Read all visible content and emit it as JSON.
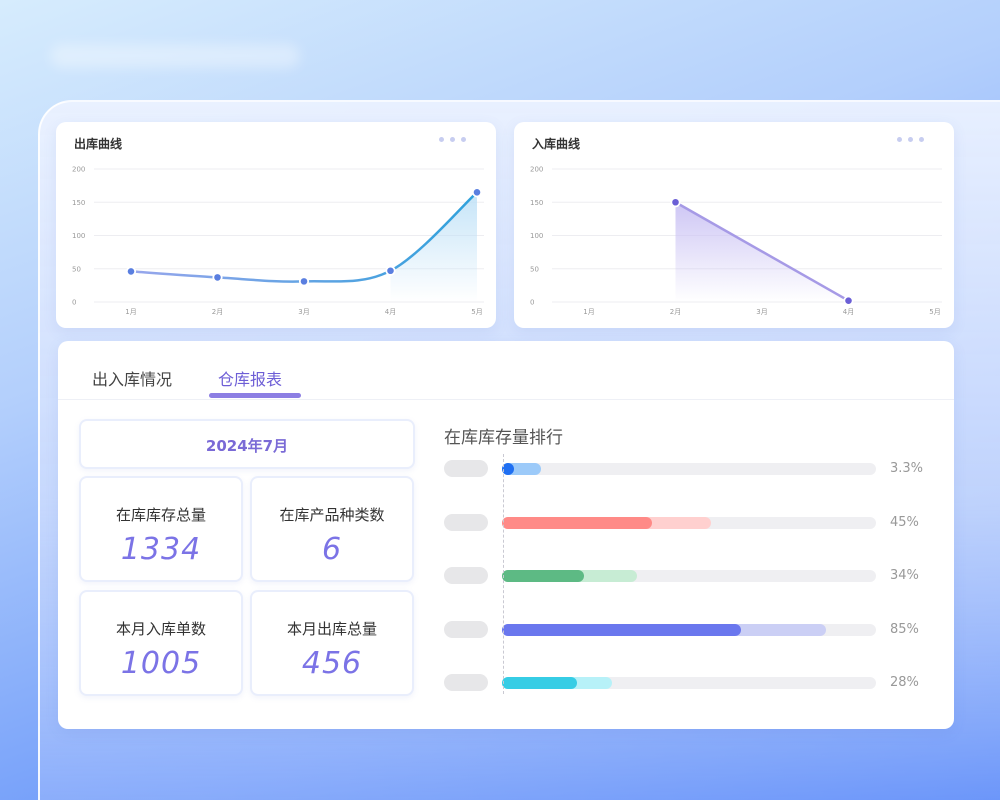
{
  "chart_data": [
    {
      "type": "area",
      "title": "出库曲线",
      "categories": [
        "1月",
        "2月",
        "3月",
        "4月",
        "5月"
      ],
      "values": [
        46,
        37,
        31,
        47,
        165
      ],
      "ylim": [
        0,
        200
      ],
      "yticks": [
        0,
        50,
        100,
        150,
        200
      ],
      "grid": true,
      "colors": {
        "line_start": "#98a6ec",
        "line_end": "#2ea1db",
        "fill": "#bfe1f7",
        "point": "#5a7fe0"
      }
    },
    {
      "type": "area",
      "title": "入库曲线",
      "categories": [
        "1月",
        "2月",
        "3月",
        "4月",
        "5月"
      ],
      "points": [
        {
          "x": "2月",
          "y": 150
        },
        {
          "x": "4月",
          "y": 2
        }
      ],
      "ylim": [
        0,
        200
      ],
      "yticks": [
        0,
        50,
        100,
        150,
        200
      ],
      "grid": true,
      "colors": {
        "line": "#a69ae6",
        "fill": "#cbc3f4",
        "point": "#6b5fd6"
      }
    }
  ],
  "tabs": [
    {
      "label": "出入库情况",
      "active": false
    },
    {
      "label": "仓库报表",
      "active": true
    }
  ],
  "report": {
    "date": "2024年7月",
    "stats": [
      {
        "label": "在库库存总量",
        "value": "1334"
      },
      {
        "label": "在库产品种类数",
        "value": "6"
      },
      {
        "label": "本月入库单数",
        "value": "1005"
      },
      {
        "label": "本月出库总量",
        "value": "456"
      }
    ]
  },
  "ranking": {
    "title": "在库库存量排行",
    "items": [
      {
        "percent_label": "3.3%",
        "value": 3.3,
        "light": 10.5,
        "color": "#1f6ff2",
        "light_color": "#9ccaf9"
      },
      {
        "percent_label": "45%",
        "value": 40,
        "light": 56,
        "color": "#ff8a87",
        "light_color": "#ffd0cf"
      },
      {
        "percent_label": "34%",
        "value": 22,
        "light": 36,
        "color": "#5dba84",
        "light_color": "#c7ecd4"
      },
      {
        "percent_label": "85%",
        "value": 64,
        "light": 86.5,
        "color": "#6a77ee",
        "light_color": "#cbcff5"
      },
      {
        "percent_label": "28%",
        "value": 20,
        "light": 29.5,
        "color": "#36cde5",
        "light_color": "#b7f1f8"
      }
    ]
  }
}
